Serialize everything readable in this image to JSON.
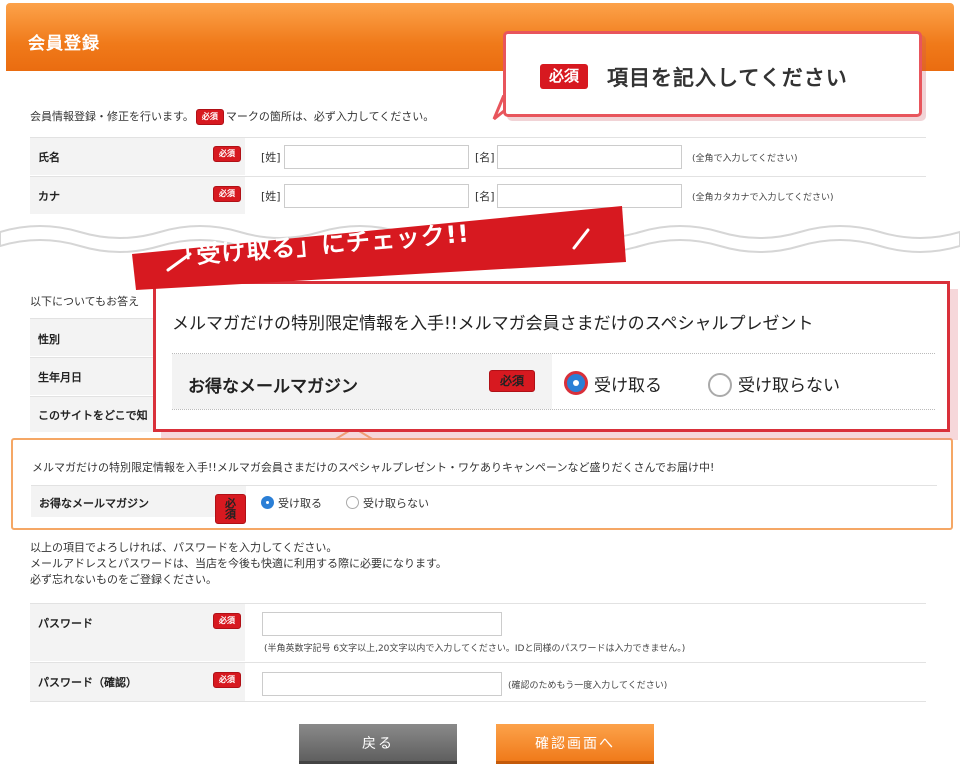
{
  "header": {
    "title": "会員登録"
  },
  "callout_required": {
    "badge": "必須",
    "text": "項目を記入してください"
  },
  "intro": {
    "before": "会員情報登録・修正を行います。",
    "badge": "必須",
    "after": "マークの箇所は、必ず入力してください。"
  },
  "required_label": "必須",
  "name_row": {
    "label": "氏名",
    "last_tag": "[姓]",
    "first_tag": "[名]",
    "hint": "(全角で入力してください)"
  },
  "kana_row": {
    "label": "カナ",
    "last_tag": "[姓]",
    "first_tag": "[名]",
    "hint": "(全角カタカナで入力してください)"
  },
  "optional_intro": "以下についてもお答え",
  "hidden_rows": [
    "性別",
    "生年月日",
    "このサイトをどこで知"
  ],
  "banner": {
    "text": "「受け取る」にチェック!!"
  },
  "popup": {
    "title": "メルマガだけの特別限定情報を入手!!メルマガ会員さまだけのスペシャルプレゼント",
    "label": "お得なメールマガジン",
    "badge": "必須",
    "opt_receive": "受け取る",
    "opt_decline": "受け取らない"
  },
  "newsletter": {
    "text": "メルマガだけの特別限定情報を入手!!メルマガ会員さまだけのスペシャルプレゼント・ワケありキャンペーンなど盛りだくさんでお届け中!",
    "label": "お得なメールマガジン",
    "opt_receive": "受け取る",
    "opt_decline": "受け取らない",
    "selected": "受け取る"
  },
  "password_intro": {
    "line1": "以上の項目でよろしければ、パスワードを入力してください。",
    "line2": "メールアドレスとパスワードは、当店を今後も快適に利用する際に必要になります。",
    "line3": "必ず忘れないものをご登録ください。"
  },
  "password_row": {
    "label": "パスワード",
    "hint": "(半角英数字記号 6文字以上,20文字以内で入力してください。IDと同様のパスワードは入力できません。)"
  },
  "password_confirm_row": {
    "label": "パスワード（確認）",
    "hint": "(確認のためもう一度入力してください)"
  },
  "buttons": {
    "back": "戻る",
    "confirm": "確認画面へ"
  }
}
